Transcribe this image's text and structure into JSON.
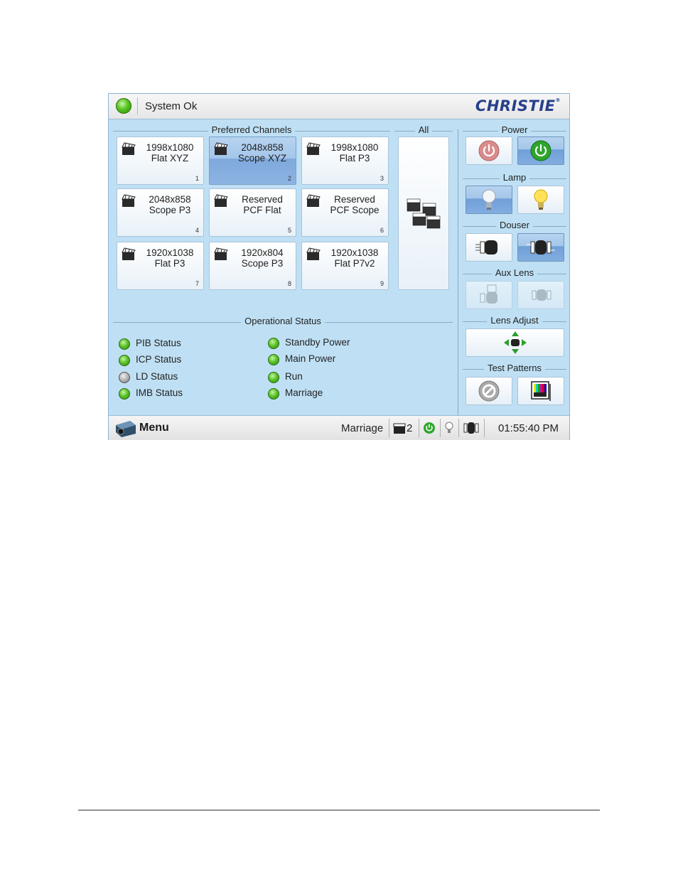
{
  "header": {
    "status_text": "System Ok",
    "brand": "CHRISTIE"
  },
  "groups": {
    "preferred": "Preferred Channels",
    "all": "All",
    "power": "Power",
    "lamp": "Lamp",
    "douser": "Douser",
    "aux_lens": "Aux Lens",
    "lens_adjust": "Lens Adjust",
    "test_patterns": "Test Patterns",
    "operational": "Operational Status"
  },
  "channels": [
    {
      "line1": "1998x1080",
      "line2": "Flat XYZ",
      "number": "1",
      "selected": false
    },
    {
      "line1": "2048x858",
      "line2": "Scope XYZ",
      "number": "2",
      "selected": true
    },
    {
      "line1": "1998x1080",
      "line2": "Flat P3",
      "number": "3",
      "selected": false
    },
    {
      "line1": "2048x858",
      "line2": "Scope P3",
      "number": "4",
      "selected": false
    },
    {
      "line1": "Reserved",
      "line2": "PCF Flat",
      "number": "5",
      "selected": false
    },
    {
      "line1": "Reserved",
      "line2": "PCF Scope",
      "number": "6",
      "selected": false
    },
    {
      "line1": "1920x1038",
      "line2": "Flat P3",
      "number": "7",
      "selected": false
    },
    {
      "line1": "1920x804",
      "line2": "Scope P3",
      "number": "8",
      "selected": false
    },
    {
      "line1": "1920x1038",
      "line2": "Flat P7v2",
      "number": "9",
      "selected": false
    }
  ],
  "status_left": [
    {
      "label": "PIB Status",
      "state": "ok"
    },
    {
      "label": "ICP Status",
      "state": "ok"
    },
    {
      "label": "LD Status",
      "state": "inactive"
    },
    {
      "label": "IMB Status",
      "state": "ok"
    }
  ],
  "status_right": [
    {
      "label": "Standby Power",
      "state": "ok"
    },
    {
      "label": "Main Power",
      "state": "ok"
    },
    {
      "label": "Run",
      "state": "ok"
    },
    {
      "label": "Marriage",
      "state": "ok"
    }
  ],
  "footer": {
    "menu_label": "Menu",
    "marriage_label": "Marriage",
    "channel_number": "2",
    "time": "01:55:40 PM"
  },
  "colors": {
    "panel_bg": "#bfe0f4",
    "selected": "#8cb3e2",
    "led_ok": "#57c41f",
    "led_off": "#b3b3b3",
    "brand": "#27408b"
  }
}
